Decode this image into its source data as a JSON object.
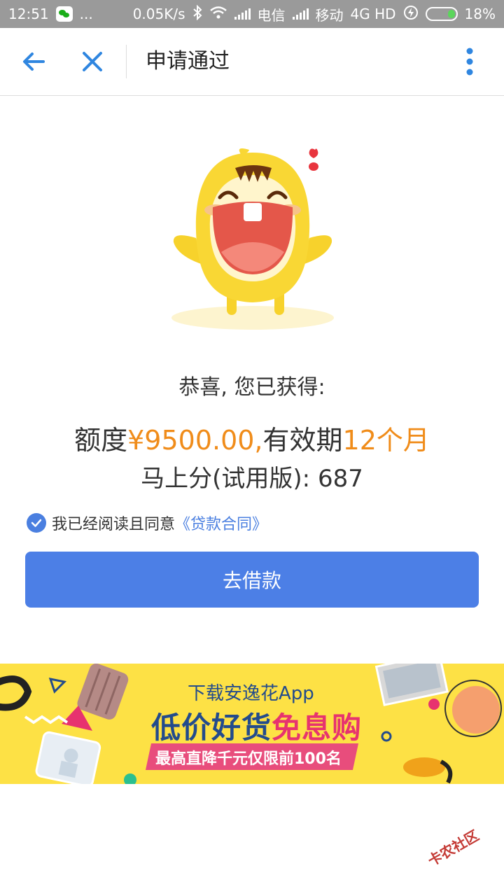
{
  "status_bar": {
    "time": "12:51",
    "more": "...",
    "speed": "0.05K/s",
    "carrier1": "电信",
    "carrier2": "移动",
    "network": "4G HD",
    "battery": "18%"
  },
  "nav": {
    "title": "申请通过",
    "icons": [
      "back-arrow-icon",
      "close-icon",
      "more-vertical-icon"
    ]
  },
  "main": {
    "congrats": "恭喜, 您已获得:",
    "quota_prefix": "额度",
    "quota_amount": "¥9500.00,",
    "validity_prefix": "有效期",
    "validity_value": "12个月",
    "score_text": "马上分(试用版): 687",
    "agree_text": "我已经阅读且同意",
    "contract_link": "《贷款合同》",
    "borrow_button": "去借款"
  },
  "banner": {
    "line1": "下载安逸花App",
    "line2_prefix": "低价好货",
    "line2_highlight": "免息购",
    "line3": "最高直降千元仅限前100名"
  },
  "watermark": "卡农社区",
  "colors": {
    "accent": "#4c7fe6",
    "orange": "#f08c1a",
    "banner_bg": "#fde145"
  }
}
